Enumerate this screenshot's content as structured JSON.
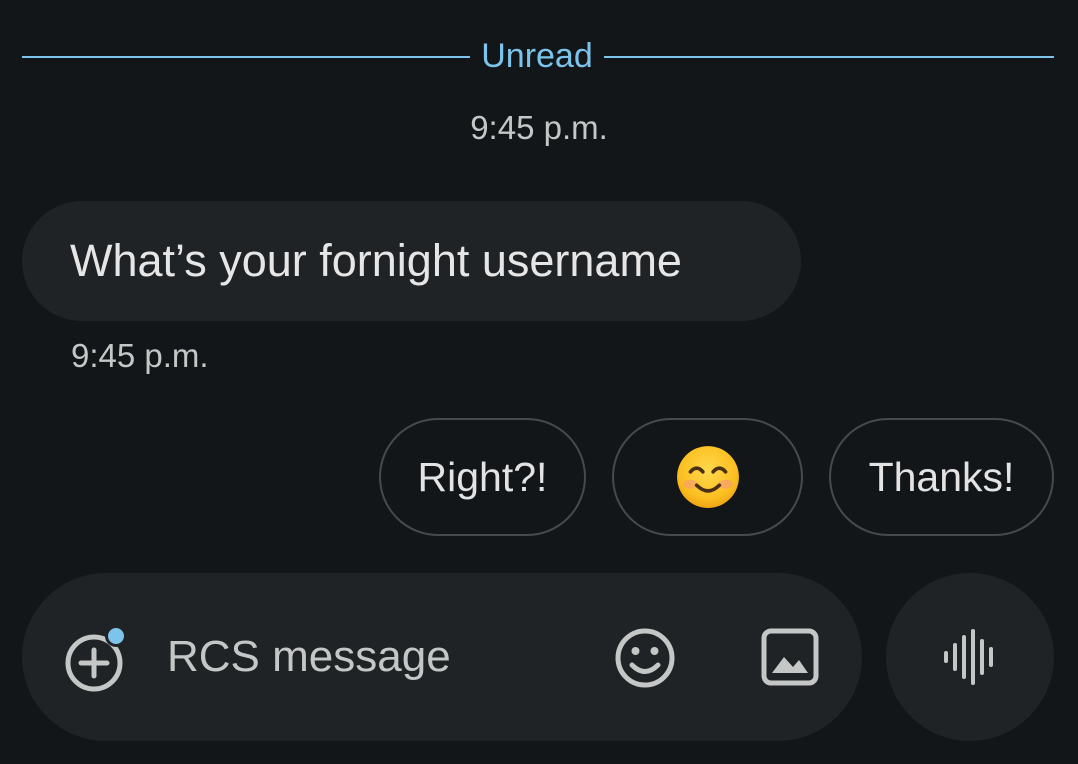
{
  "divider": {
    "label": "Unread"
  },
  "conversation": {
    "day_time": "9:45 p.m.",
    "messages": [
      {
        "text": "What’s your fornight username",
        "time": "9:45 p.m."
      }
    ]
  },
  "smart_replies": {
    "items": [
      {
        "label": "Right?!"
      },
      {
        "label": "",
        "icon": "smiling-face-emoji"
      },
      {
        "label": "Thanks!"
      }
    ]
  },
  "composer": {
    "placeholder": "RCS message",
    "icons": [
      "add-attachment-icon",
      "emoji-icon",
      "gallery-icon",
      "voice-message-icon"
    ]
  },
  "colors": {
    "background": "#131619",
    "bubble": "#202326",
    "accent": "#7cc4ec",
    "chip_border": "#454a4e"
  }
}
